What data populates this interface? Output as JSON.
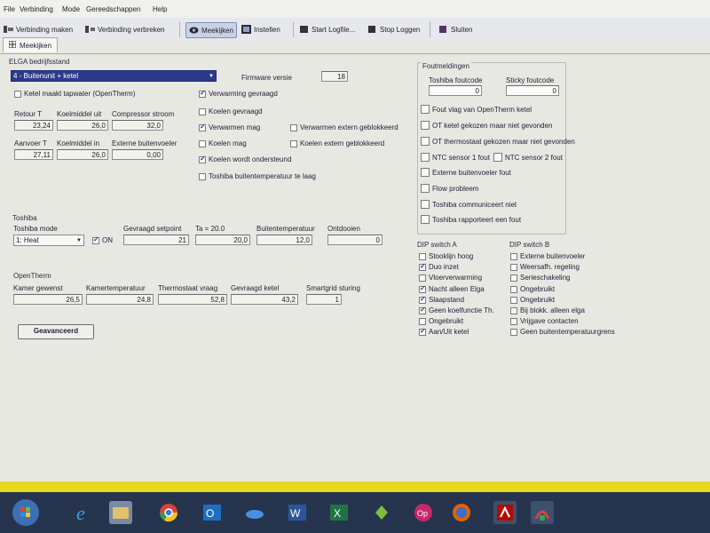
{
  "menu": [
    "File",
    "Verbinding",
    "Mode",
    "Gereedschappen",
    "Help"
  ],
  "toolbar": {
    "connect": "Verbinding maken",
    "disconnect": "Verbinding verbreken",
    "monitor": "Meekijken",
    "settings": "Instellen",
    "start_log": "Start Logfile...",
    "stop_log": "Stop Loggen",
    "close": "Sluiten"
  },
  "tab": "Meekijken",
  "elga": {
    "title": "ELGA bedrijfsstand",
    "mode_value": "4 - Buitenunit + ketel",
    "firmware_label": "Firmware versie",
    "firmware_value": "18",
    "tapwater": "Ketel maakt tapwater (OpenTherm)",
    "retour_label": "Retour T",
    "retour_value": "23,24",
    "koel_uit_label": "Koelmiddel uit",
    "koel_uit_value": "26,0",
    "compressor_label": "Compressor stroom",
    "compressor_value": "32,0",
    "aanvoer_label": "Aanvoer T",
    "aanvoer_value": "27,11",
    "koel_in_label": "Koelmiddel in",
    "koel_in_value": "26,0",
    "ext_label": "Externe buitenvoeler",
    "ext_value": "0,00",
    "flags": {
      "verwarming_gevraagd": "Verwarming gevraagd",
      "koelen_gevraagd": "Koelen gevraagd",
      "verwarmen_mag": "Verwarmen mag",
      "koelen_mag": "Koelen mag",
      "koelen_ondersteund": "Koelen wordt ondersteund",
      "toshiba_buiten_laag": "Toshiba buitentemperatuur te laag",
      "verwarmen_extern": "Verwarmen extern geblokkeerd",
      "koelen_extern": "Koelen extern geblokkeerd"
    }
  },
  "toshiba": {
    "title": "Toshiba",
    "mode_label": "Toshiba mode",
    "mode_value": "1: Heat",
    "on_label": "ON",
    "setpoint_label": "Gevraagd setpoint",
    "setpoint_value": "21",
    "ta_label": "Ta = 20.0",
    "ta_value": "20,0",
    "buiten_label": "Buitentemperatuur",
    "buiten_value": "12,0",
    "ontdooien_label": "Ontdooien",
    "ontdooien_value": "0"
  },
  "opentherm": {
    "title": "OpenTherm",
    "kamer_gewenst_label": "Kamer gewenst",
    "kamer_gewenst_value": "26,5",
    "kamertemp_label": "Kamertemperatuur",
    "kamertemp_value": "24,8",
    "thermostaat_label": "Thermostaat vraag",
    "thermostaat_value": "52,8",
    "ketel_label": "Gevraagd ketel",
    "ketel_value": "43,2",
    "smartgrid_label": "Smartgrid sturing",
    "smartgrid_value": "1"
  },
  "advanced_button": "Geavanceerd",
  "foutmeldingen": {
    "title": "Foutmeldingen",
    "toshiba_code_label": "Toshiba foutcode",
    "toshiba_code_value": "0",
    "sticky_label": "Sticky foutcode",
    "sticky_value": "0",
    "errors": [
      "Fout vlag van OpenTherm ketel",
      "OT ketel gekozen maar niet gevonden",
      "OT thermostaat gekozen maar niet gevonden",
      "NTC sensor 1 fout",
      "NTC sensor 2 fout",
      "Externe buitenvoeler fout",
      "Flow probleem",
      "Toshiba communiceert niet",
      "Toshiba rapporteert een fout"
    ]
  },
  "dip_a": {
    "title": "DIP switch A",
    "items": [
      "Stooklijn hoog",
      "Duo inzet",
      "Vloerverwarming",
      "Nacht alleen Elga",
      "Slaapstand",
      "Geen koelfunctie Th.",
      "Ongebruikt",
      "Aan/Uit ketel"
    ]
  },
  "dip_b": {
    "title": "DIP switch B",
    "items": [
      "Externe buitenvoeler",
      "Weersafh. regeling",
      "Serieschakeling",
      "Ongebruikt",
      "Ongebruikt",
      "Bij blokk. alleen elga",
      "Vrijgave contacten",
      "Geen buitentemperatuurgrens"
    ]
  },
  "colors": {
    "taskbar": "#26344d",
    "yellow_bar": "#e7d91c",
    "check": "#1c3f9a"
  },
  "taskbar_icons": [
    "windows-start-icon",
    "internet-explorer-icon",
    "file-explorer-icon",
    "chrome-icon",
    "outlook-icon",
    "onedrive-icon",
    "word-icon",
    "excel-icon",
    "green-app-icon",
    "opera-icon",
    "firefox-icon",
    "acrobat-icon",
    "signal-app-icon"
  ]
}
